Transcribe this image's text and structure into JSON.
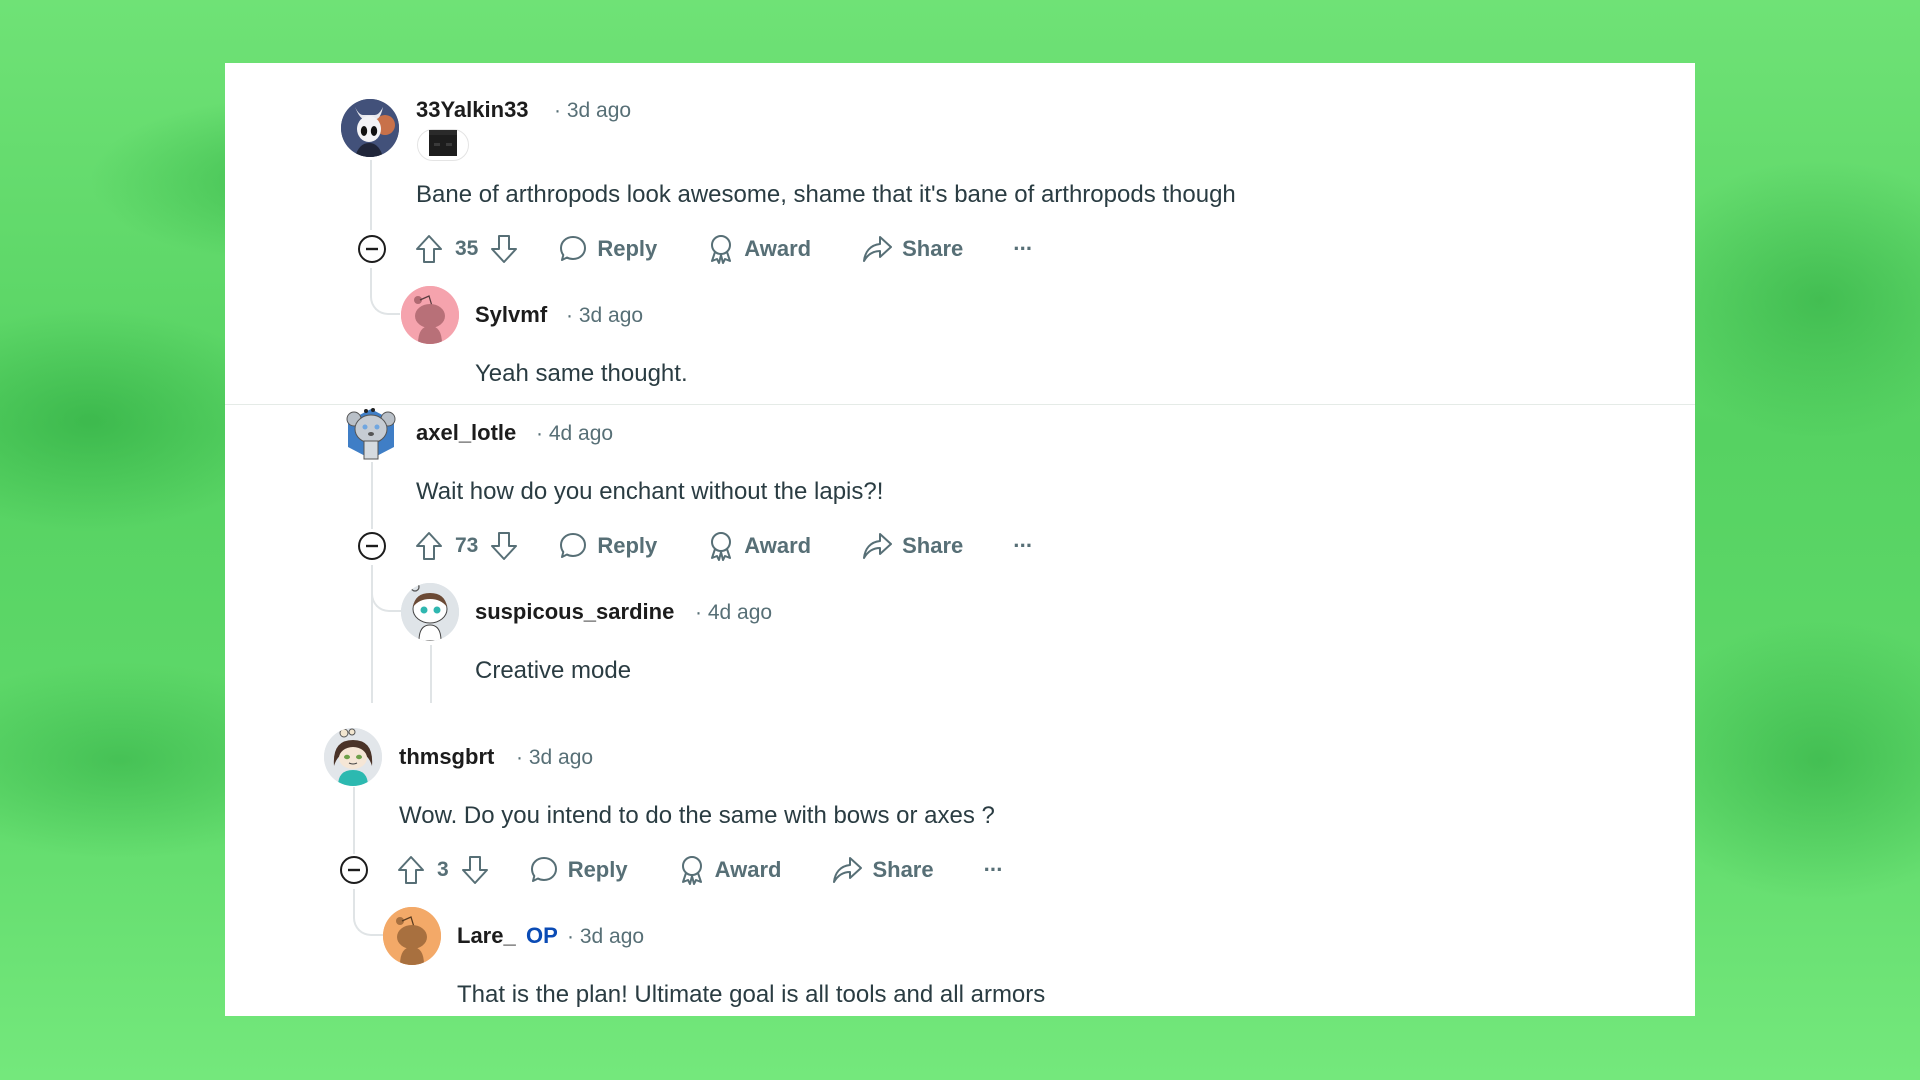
{
  "comments": [
    {
      "username": "33Yalkin33",
      "time": "3d ago",
      "flair_icon": "blocky-mob-face-icon",
      "body": "Bane of arthropods look awesome, shame that it's bane of arthropods though",
      "score": "35",
      "reply": {
        "username": "Sylvmf",
        "time": "3d ago",
        "body": "Yeah same thought."
      }
    },
    {
      "username": "axel_lotle",
      "time": "4d ago",
      "body": "Wait how do you enchant without the lapis?!",
      "score": "73",
      "reply": {
        "username": "suspicous_sardine",
        "time": "4d ago",
        "body": "Creative mode"
      }
    },
    {
      "username": "thmsgbrt",
      "time": "3d ago",
      "body": "Wow. Do you intend to do the same with bows or axes ?",
      "score": "3",
      "reply": {
        "username": "Lare_",
        "op_badge": "OP",
        "time": "3d ago",
        "body": "That is the plan! Ultimate goal is all tools and all armors"
      }
    }
  ],
  "actions": {
    "reply_label": "Reply",
    "award_label": "Award",
    "share_label": "Share",
    "more_label": "···"
  },
  "separator": "·",
  "colors": {
    "background_green": "#5fd96a",
    "text_primary": "#1c1c1c",
    "text_secondary": "#576f76",
    "op_blue": "#0a4bb5",
    "avatar_pink": "#f5a3ad",
    "avatar_orange": "#f3a968"
  }
}
